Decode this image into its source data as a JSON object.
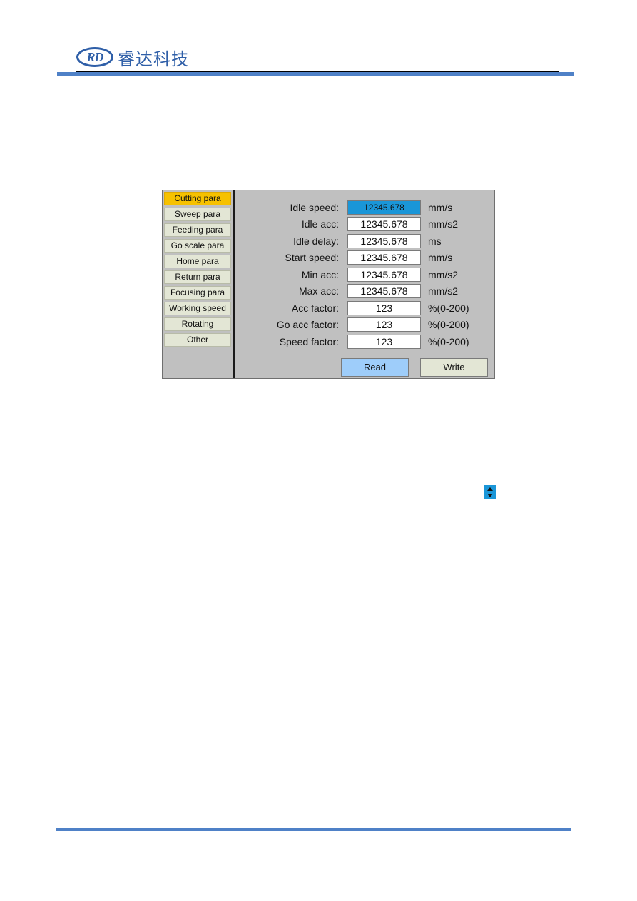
{
  "header": {
    "logo_mark": "RD",
    "company_name": "睿达科技"
  },
  "panel": {
    "sidebar": {
      "items": [
        {
          "label": "Cutting para",
          "active": true
        },
        {
          "label": "Sweep para",
          "active": false
        },
        {
          "label": "Feeding para",
          "active": false
        },
        {
          "label": "Go scale para",
          "active": false
        },
        {
          "label": "Home para",
          "active": false
        },
        {
          "label": "Return para",
          "active": false
        },
        {
          "label": "Focusing para",
          "active": false
        },
        {
          "label": "Working speed",
          "active": false
        },
        {
          "label": "Rotating",
          "active": false
        },
        {
          "label": "Other",
          "active": false
        }
      ]
    },
    "fields": [
      {
        "label": "Idle speed:",
        "value": "12345.678",
        "unit": "mm/s",
        "selected": true
      },
      {
        "label": "Idle acc:",
        "value": "12345.678",
        "unit": "mm/s2",
        "selected": false
      },
      {
        "label": "Idle delay:",
        "value": "12345.678",
        "unit": "ms",
        "selected": false
      },
      {
        "label": "Start speed:",
        "value": "12345.678",
        "unit": "mm/s",
        "selected": false
      },
      {
        "label": "Min acc:",
        "value": "12345.678",
        "unit": "mm/s2",
        "selected": false
      },
      {
        "label": "Max acc:",
        "value": "12345.678",
        "unit": "mm/s2",
        "selected": false
      },
      {
        "label": "Acc factor:",
        "value": "123",
        "unit": "%(0-200)",
        "selected": false
      },
      {
        "label": "Go acc factor:",
        "value": "123",
        "unit": "%(0-200)",
        "selected": false
      },
      {
        "label": "Speed factor:",
        "value": "123",
        "unit": "%(0-200)",
        "selected": false
      }
    ],
    "buttons": {
      "read_label": "Read",
      "write_label": "Write"
    }
  },
  "icons": {
    "spin": "up-down-arrows-icon"
  },
  "colors": {
    "brand_blue": "#2f5fa8",
    "rule_blue": "#4f81c7",
    "active_tab": "#f6c100",
    "selected_field": "#1a96d8",
    "read_button": "#9ecdfa",
    "panel_bg": "#c0c0c0"
  }
}
